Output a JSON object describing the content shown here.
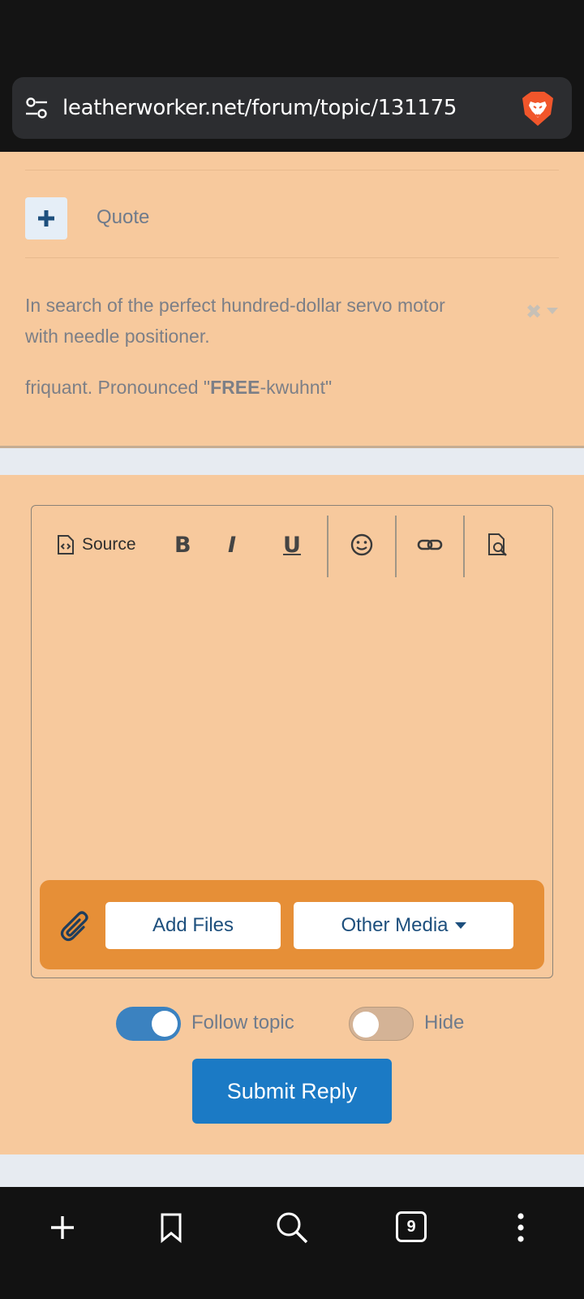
{
  "browser": {
    "url": "leatherworker.net/forum/topic/131175",
    "tab_count": "9",
    "icons": {
      "site_settings": "tune-icon",
      "brand": "brave-lion-icon",
      "new_tab": "plus-icon",
      "bookmarks": "bookmark-icon",
      "search": "search-icon",
      "tabs": "tabs-icon",
      "menu": "more-vert-icon"
    }
  },
  "post": {
    "quote_label": "Quote",
    "signature_line1": "In search of the perfect hundred-dollar servo motor",
    "signature_line2": "with needle positioner.",
    "signature_line3_pre": "friquant. Pronounced \"",
    "signature_line3_bold": "FREE",
    "signature_line3_post": "-kwuhnt\""
  },
  "editor": {
    "source_label": "Source",
    "bold_label": "B",
    "italic_label": "I",
    "underline_label": "U",
    "add_files_label": "Add Files",
    "other_media_label": "Other Media"
  },
  "options": {
    "follow_label": "Follow topic",
    "follow_on": true,
    "hide_label": "Hide",
    "hide_on": false
  },
  "submit_label": "Submit Reply",
  "colors": {
    "page_bg": "#f7c99d",
    "accent_orange": "#e68f37",
    "primary_blue": "#1b7ac5",
    "toggle_on": "#3b82c0"
  }
}
